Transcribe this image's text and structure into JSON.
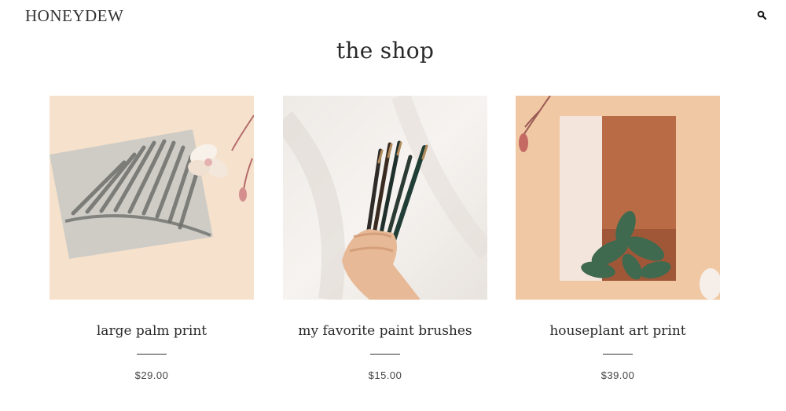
{
  "header": {
    "logo": "HONEYDEW",
    "search_icon": "search-icon"
  },
  "page": {
    "title": "the shop"
  },
  "products": [
    {
      "name": "large palm print",
      "price": "$29.00",
      "image": "palm-print-image"
    },
    {
      "name": "my favorite paint brushes",
      "price": "$15.00",
      "image": "paint-brushes-image"
    },
    {
      "name": "houseplant art print",
      "price": "$39.00",
      "image": "houseplant-print-image"
    }
  ],
  "colors": {
    "background": "#ffffff",
    "text": "#2a2a2a",
    "peach": "#f5dec6",
    "terracotta": "#b5653e"
  }
}
